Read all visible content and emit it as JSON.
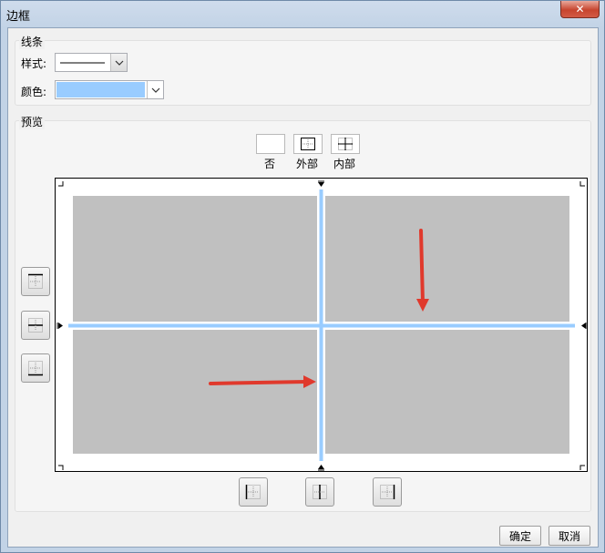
{
  "window": {
    "title": "边框",
    "close_label": "✕"
  },
  "line_group": {
    "label": "线条",
    "style_label": "样式:",
    "color_label": "颜色:",
    "color_value": "#99ccff"
  },
  "preview_group": {
    "label": "预览",
    "presets": [
      {
        "label": "否"
      },
      {
        "label": "外部"
      },
      {
        "label": "内部"
      }
    ]
  },
  "colors": {
    "cell_fill": "#c0c0c0",
    "border_line": "#99ccff",
    "arrow": "#e0392c"
  },
  "footer": {
    "ok_label": "确定",
    "cancel_label": "取消"
  }
}
